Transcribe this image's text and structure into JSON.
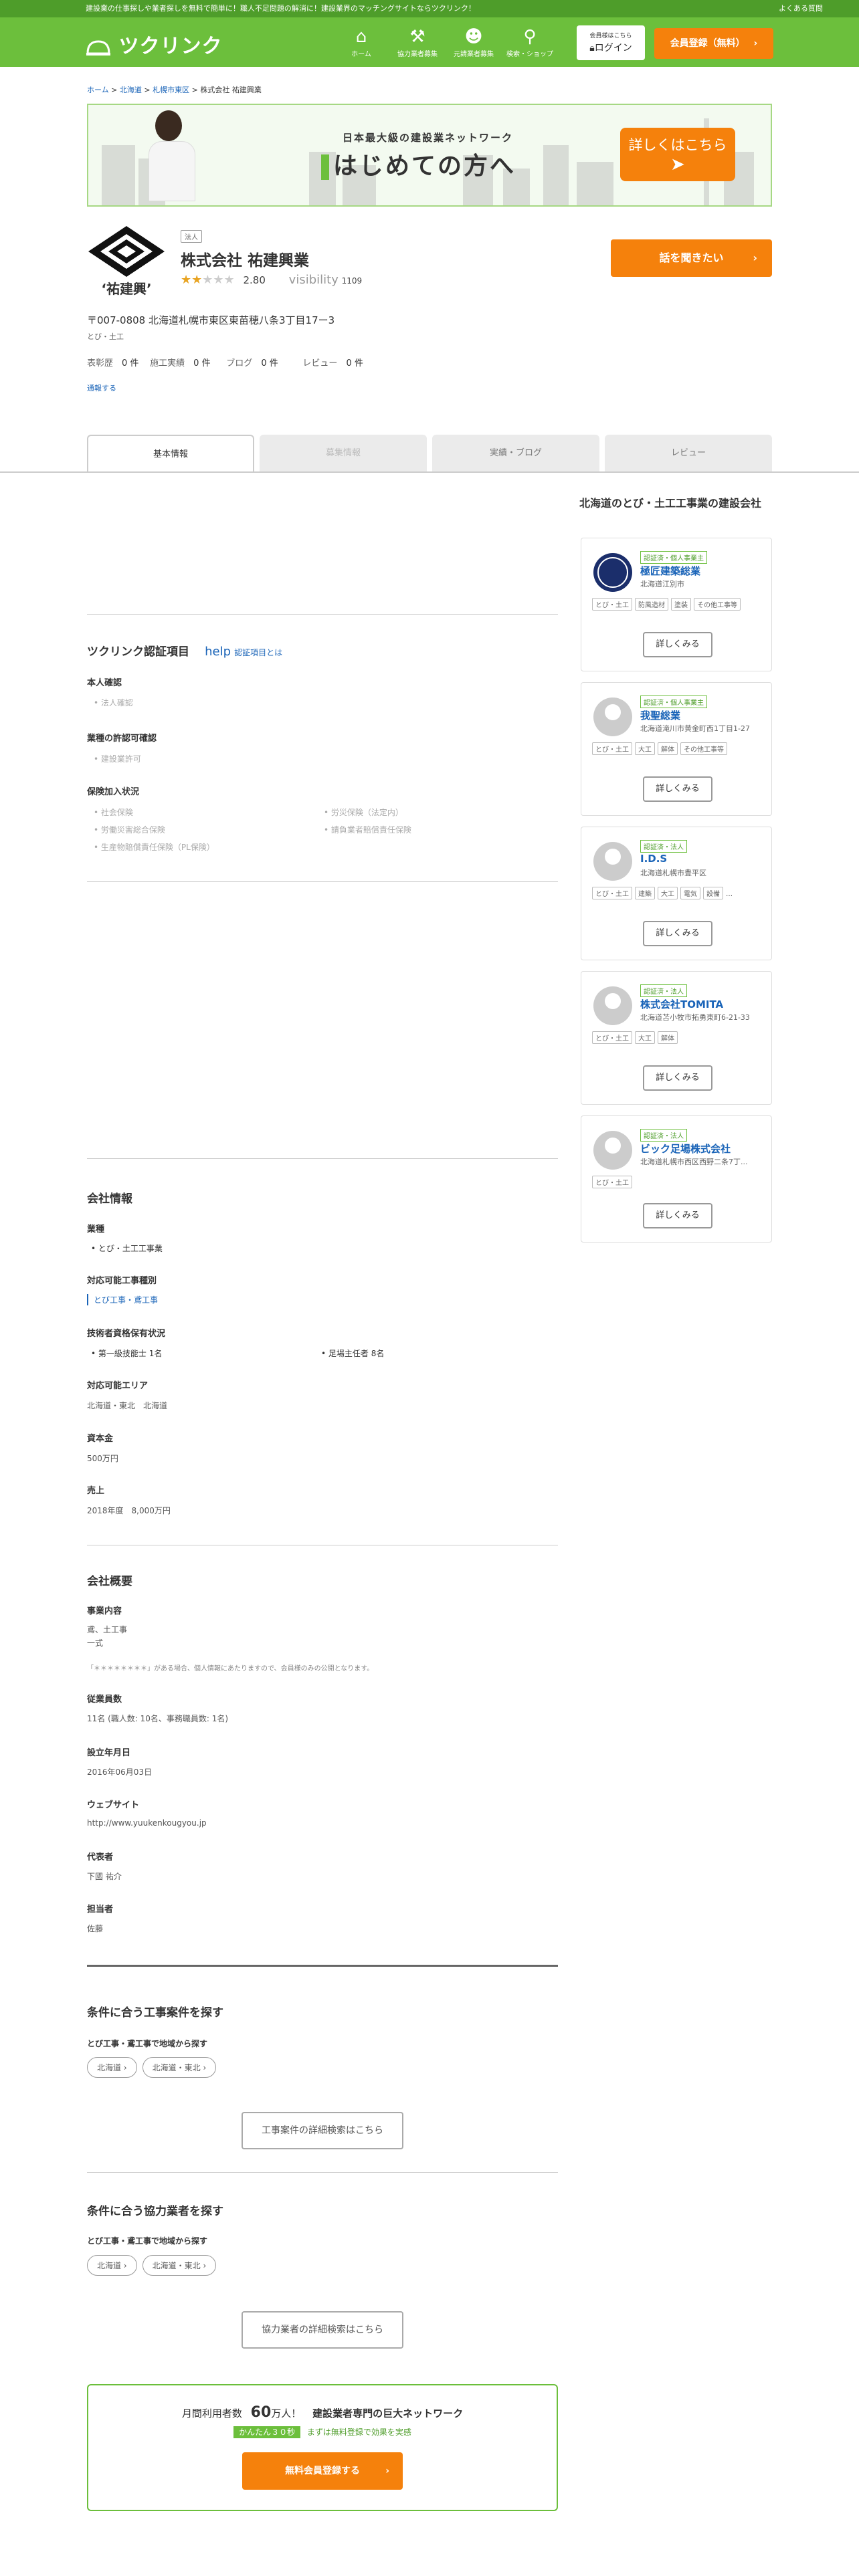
{
  "topbar": {
    "text": "建設業の仕事探しや業者探しを無料で簡単に！職人不足問題の解消に！建設業界のマッチングサイトならツクリンク！",
    "faq": "よくある質問"
  },
  "header": {
    "logo": "ツクリンク",
    "nav": [
      {
        "icon": "home-icon",
        "label": "ホーム"
      },
      {
        "icon": "hammer-icon",
        "label": "協力業者募集"
      },
      {
        "icon": "worker-icon",
        "label": "元請業者募集"
      },
      {
        "icon": "search-shop-icon",
        "label": "検索・ショップ"
      }
    ],
    "login_small": "会員様はこちら",
    "login": "ログイン",
    "register": "会員登録（無料）"
  },
  "breadcrumb": {
    "home": "ホーム",
    "pref": "北海道",
    "city": "札幌市東区",
    "current": "株式会社 祐建興業"
  },
  "banner": {
    "sub": "日本最大級の建設業ネットワーク",
    "main": "はじめての方へ",
    "button": "詳しくはこちら"
  },
  "company": {
    "tag": "法人",
    "name": "株式会社 祐建興業",
    "rating": "2.80",
    "visibility_label": "visibility",
    "views": "1109",
    "address": "〒007-0808 北海道札幌市東区東苗穂八条3丁目17ー3",
    "category": "とび・土工",
    "talk_button": "話を聞きたい",
    "report": "通報する",
    "stats": [
      {
        "label": "表彰歴",
        "value": "0 件"
      },
      {
        "label": "施工実績",
        "value": "0 件"
      },
      {
        "label": "ブログ",
        "value": "0 件"
      },
      {
        "label": "レビュー",
        "value": "0 件"
      }
    ],
    "logo_text": "祐建興"
  },
  "tabs": [
    "基本情報",
    "募集情報",
    "実績・ブログ",
    "レビュー"
  ],
  "cert": {
    "title": "ツクリンク認証項目",
    "help_icon_text": "help",
    "help_link": "認証項目とは",
    "identity_title": "本人確認",
    "identity_item": "法人確認",
    "permit_title": "業種の許認可確認",
    "permit_item": "建設業許可",
    "insurance_title": "保険加入状況",
    "insurance_items": [
      "社会保険",
      "労働災害総合保険",
      "生産物賠償責任保険（PL保険）",
      "労災保険（法定内）",
      "請負業者賠償責任保険"
    ]
  },
  "info": {
    "title": "会社情報",
    "industry_title": "業種",
    "industry": "とび・土工工事業",
    "work_title": "対応可能工事種別",
    "work": "とび工事・鳶工事",
    "qual_title": "技術者資格保有状況",
    "quals": [
      "第一級技能士 1名",
      "足場主任者 8名"
    ],
    "area_title": "対応可能エリア",
    "area": "北海道・東北　北海道",
    "capital_title": "資本金",
    "capital": "500万円",
    "sales_title": "売上",
    "sales": "2018年度　8,000万円"
  },
  "overview": {
    "title": "会社概要",
    "content_title": "事業内容",
    "content1": "鳶、土工事",
    "content2": "一式",
    "note": "「＊＊＊＊＊＊＊＊」がある場合、個人情報にあたりますので、会員様のみの公開となります。",
    "staff_title": "従業員数",
    "staff": "11名 (職人数: 10名、事務職員数: 1名)",
    "founded_title": "設立年月日",
    "founded": "2016年06月03日",
    "web_title": "ウェブサイト",
    "web": "http://www.yuukenkougyou.jp",
    "rep_title": "代表者",
    "rep": "下國 祐介",
    "contact_title": "担当者",
    "contact": "佐藤"
  },
  "search_jobs": {
    "title": "条件に合う工事案件を探す",
    "sub": "とび工事・鳶工事で地域から探す",
    "pills": [
      "北海道 ›",
      "北海道・東北 ›"
    ],
    "button": "工事案件の詳細検索はこちら"
  },
  "search_partners": {
    "title": "条件に合う協力業者を探す",
    "sub": "とび工事・鳶工事で地域から探す",
    "pills": [
      "北海道 ›",
      "北海道・東北 ›"
    ],
    "button": "協力業者の詳細検索はこちら"
  },
  "cta": {
    "prefix": "月間利用者数",
    "number": "60",
    "suffix": "万人！",
    "main": "建設業者専門の巨大ネットワーク",
    "badge": "かんたん３０秒",
    "note": "まずは無料登録で効果を実感",
    "button": "無料会員登録する"
  },
  "sidebar": {
    "title": "北海道のとび・土工工事業の建設会社",
    "detail": "詳しくみる",
    "cards": [
      {
        "badge": "認証済・個人事業主",
        "name": "極匠建築総業",
        "addr": "北海道江別市",
        "chips": [
          "とび・土工",
          "防風造材",
          "塗装",
          "その他工事等"
        ]
      },
      {
        "badge": "認証済・個人事業主",
        "name": "我聖総業",
        "addr": "北海道滝川市黄金町西1丁目1-27",
        "chips": [
          "とび・土工",
          "大工",
          "解体",
          "その他工事等"
        ]
      },
      {
        "badge": "認証済・法人",
        "name": "I.D.S",
        "addr": "北海道札幌市豊平区",
        "chips": [
          "とび・土工",
          "建築",
          "大工",
          "電気",
          "設備",
          "…"
        ]
      },
      {
        "badge": "認証済・法人",
        "name": "株式会社TOMITA",
        "addr": "北海道苫小牧市拓勇東町6-21-33",
        "chips": [
          "とび・土工",
          "大工",
          "解体"
        ]
      },
      {
        "badge": "認証済・法人",
        "name": "ビック足場株式会社",
        "addr": "北海道札幌市西区西野二条7丁...",
        "chips": [
          "とび・土工"
        ]
      }
    ]
  }
}
